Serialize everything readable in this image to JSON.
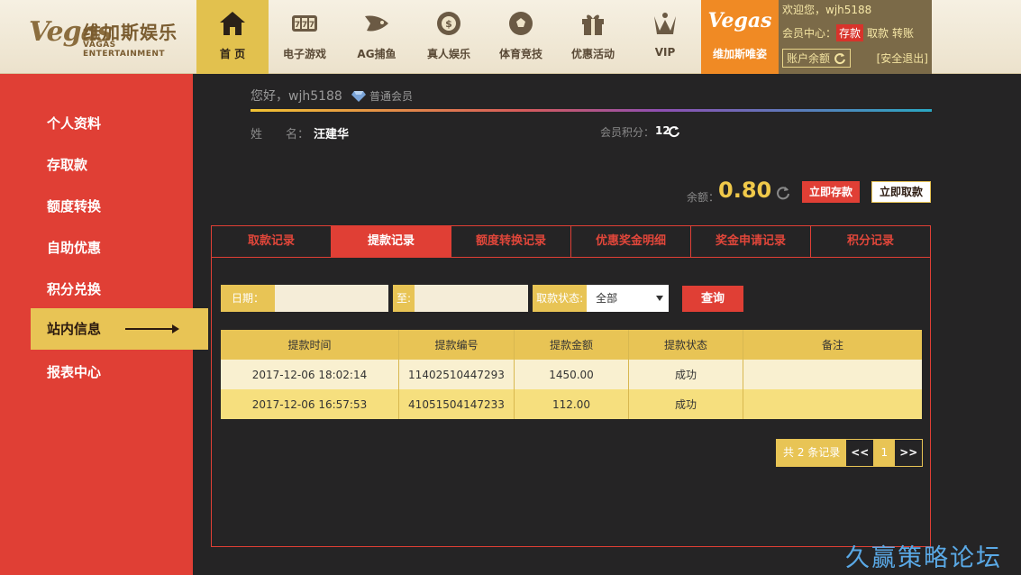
{
  "brand": {
    "logo_script": "Vegas",
    "logo_cn": "维加斯娱乐",
    "logo_en": "VAGAS ENTERTAINMENT"
  },
  "nav": {
    "items": [
      {
        "label": "首 页",
        "icon": "home-icon"
      },
      {
        "label": "电子游戏",
        "icon": "slot-machine-icon"
      },
      {
        "label": "AG捕鱼",
        "icon": "fish-icon"
      },
      {
        "label": "真人娱乐",
        "icon": "casino-chip-icon"
      },
      {
        "label": "体育竞技",
        "icon": "soccer-ball-icon"
      },
      {
        "label": "优惠活动",
        "icon": "gift-icon"
      },
      {
        "label": "VIP",
        "icon": "vip-crown-icon"
      }
    ],
    "brand_item": {
      "script": "Vegas",
      "label": "维加斯唯姿"
    }
  },
  "user_header": {
    "welcome": "欢迎您，wjh5188",
    "center_label": "会员中心：",
    "deposit": "存款",
    "withdraw": "取款",
    "transfer": "转账",
    "balance_btn": "账户余额",
    "logout": "[安全退出]"
  },
  "sidebar": {
    "items": [
      "个人资料",
      "存取款",
      "额度转换",
      "自助优惠",
      "积分兑换",
      "站内信息",
      "报表中心"
    ],
    "active": "站内信息"
  },
  "profile": {
    "greeting": "您好，wjh5188",
    "level": "普通会员",
    "name_label": "姓　　名：",
    "name_value": "汪建华",
    "points_label": "会员积分：",
    "points_value": "12"
  },
  "balance": {
    "label": "余额：",
    "value": "0.80",
    "deposit_btn": "立即存款",
    "withdraw_btn": "立即取款"
  },
  "tabs": [
    "取款记录",
    "提款记录",
    "额度转换记录",
    "优惠奖金明细",
    "奖金申请记录",
    "积分记录"
  ],
  "active_tab": "提款记录",
  "filter": {
    "date_label": "日期：",
    "to_label": "至:",
    "status_label": "取款状态:",
    "status_value": "全部",
    "query_btn": "查询"
  },
  "table": {
    "headers": [
      "提款时间",
      "提款编号",
      "提款金额",
      "提款状态",
      "备注"
    ],
    "rows": [
      [
        "2017-12-06 18:02:14",
        "11402510447293",
        "1450.00",
        "成功",
        ""
      ],
      [
        "2017-12-06 16:57:53",
        "41051504147233",
        "112.00",
        "成功",
        ""
      ]
    ]
  },
  "pagination": {
    "total": "共 2 条记录",
    "prev": "<<",
    "current": "1",
    "next": ">>"
  },
  "watermark": "久赢策略论坛",
  "colors": {
    "accent_red": "#e03f35",
    "gold": "#e8c455",
    "dark_bg": "#252425",
    "orange": "#f08a24"
  }
}
